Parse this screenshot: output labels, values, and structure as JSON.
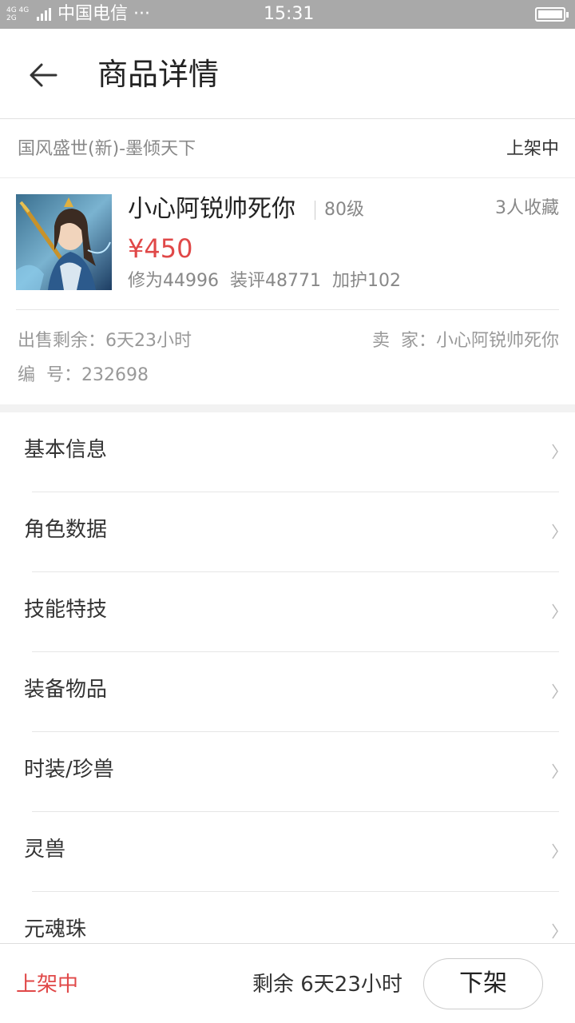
{
  "status_bar": {
    "network": "4G 4G\n2G",
    "carrier": "中国电信 ···",
    "time": "15:31",
    "battery_level": 1.0
  },
  "header": {
    "title": "商品详情"
  },
  "game": {
    "name": "国风盛世(新)-墨倾天下",
    "status": "上架中"
  },
  "product": {
    "name": "小心阿锐帅死你",
    "level": "80级",
    "favorites": "3人收藏",
    "price": "¥450",
    "stats": [
      "修为44996",
      "装评48771",
      "加护102"
    ]
  },
  "meta": {
    "time_left": "出售剩余：6天23小时",
    "seller": "卖  家：小心阿锐帅死你",
    "serial": "编  号：232698"
  },
  "menu": [
    {
      "label": "基本信息"
    },
    {
      "label": "角色数据"
    },
    {
      "label": "技能特技"
    },
    {
      "label": "装备物品"
    },
    {
      "label": "时装/珍兽"
    },
    {
      "label": "灵兽"
    },
    {
      "label": "元魂珠"
    }
  ],
  "bottom": {
    "status": "上架中",
    "remaining": "剩余 6天23小时",
    "button": "下架"
  },
  "colors": {
    "accent": "#e04848",
    "status_bar": "#a9a9a9"
  }
}
